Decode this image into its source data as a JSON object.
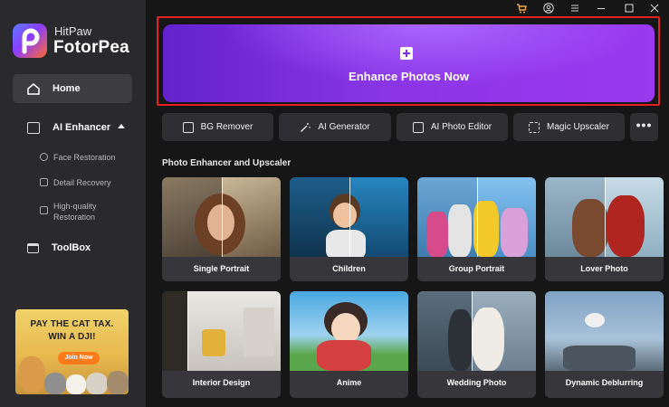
{
  "app": {
    "brand_small": "HitPaw",
    "brand_big": "FotorPea"
  },
  "titlebar": {
    "icons": [
      "cart-icon",
      "account-icon",
      "menu-icon",
      "minimize-icon",
      "maximize-icon",
      "close-icon"
    ]
  },
  "sidebar": {
    "home": "Home",
    "ai_enhancer": "AI Enhancer",
    "sub_items": [
      "Face Restoration",
      "Detail Recovery",
      "High-quality Restoration"
    ],
    "toolbox": "ToolBox",
    "promo": {
      "line1": "PAY THE CAT TAX.",
      "line2": "WIN A DJI!",
      "button": "Join Now"
    }
  },
  "hero": {
    "label": "Enhance Photos Now"
  },
  "tools": [
    "BG Remover",
    "AI Generator",
    "AI Photo Editor",
    "Magic Upscaler"
  ],
  "more_label": "•••",
  "section_title": "Photo Enhancer and Upscaler",
  "cards": [
    "Single Portrait",
    "Children",
    "Group Portrait",
    "Lover Photo",
    "Interior Design",
    "Anime",
    "Wedding Photo",
    "Dynamic Deblurring"
  ],
  "colors": {
    "sidebar": "#2a2a2d",
    "background": "#161616",
    "hero_start": "#6322cc",
    "hero_end": "#9b38f0",
    "highlight": "#e42020"
  }
}
